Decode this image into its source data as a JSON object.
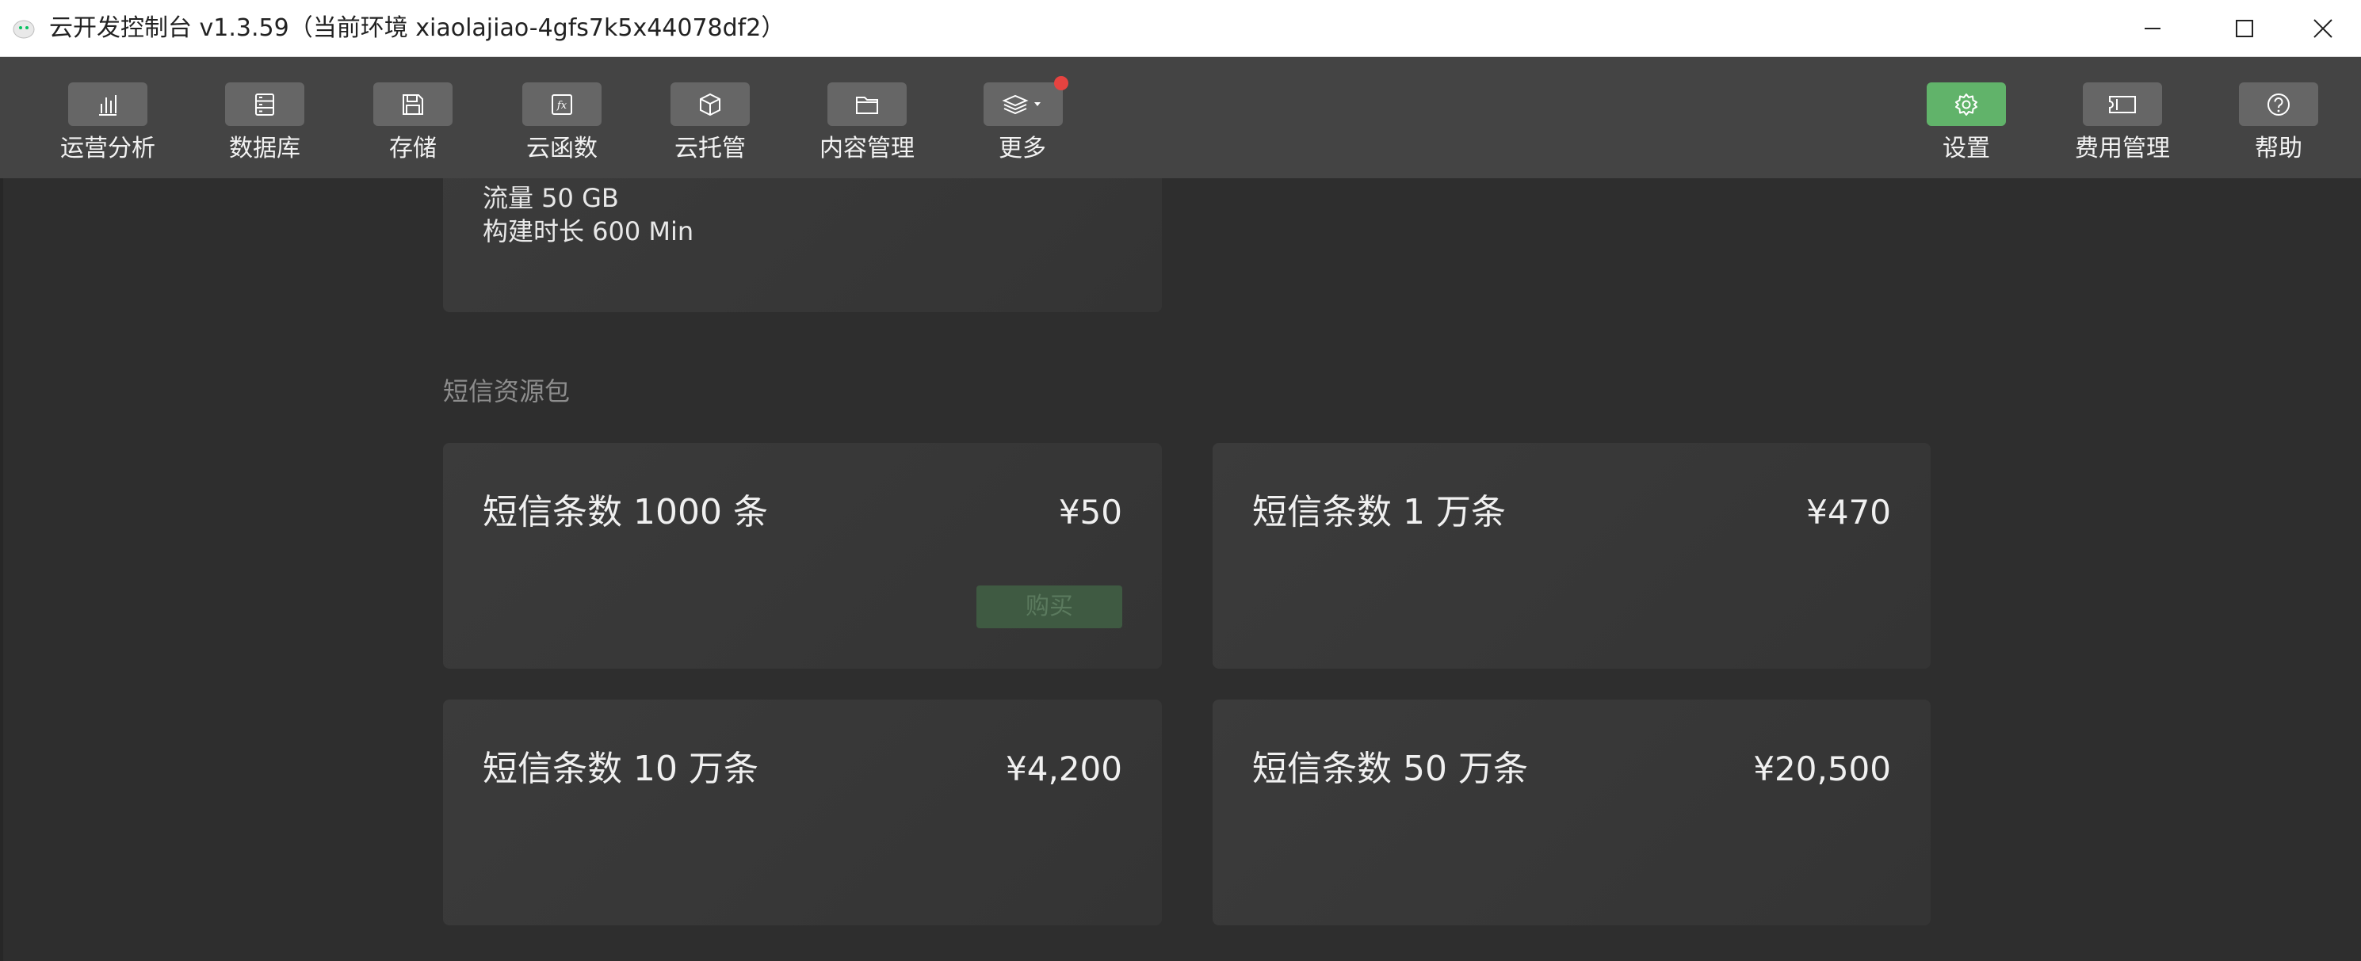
{
  "window": {
    "title": "云开发控制台 v1.3.59（当前环境 xiaolajiao-4gfs7k5x44078df2）",
    "icons": {
      "app": "wechat-cloud-logo-icon",
      "minimize": "minimize-icon",
      "maximize": "maximize-icon",
      "close": "close-icon"
    }
  },
  "toolbar": {
    "left_items": [
      {
        "label": "运营分析",
        "icon": "bar-chart-icon"
      },
      {
        "label": "数据库",
        "icon": "database-icon"
      },
      {
        "label": "存储",
        "icon": "floppy-disk-icon"
      },
      {
        "label": "云函数",
        "icon": "function-icon"
      },
      {
        "label": "云托管",
        "icon": "cube-icon"
      },
      {
        "label": "内容管理",
        "icon": "folder-icon"
      },
      {
        "label": "更多",
        "icon": "layers-icon"
      }
    ],
    "right_items": [
      {
        "label": "设置",
        "icon": "gear-icon"
      },
      {
        "label": "费用管理",
        "icon": "ticket-icon"
      },
      {
        "label": "帮助",
        "icon": "question-icon"
      }
    ],
    "fx_glyph": "fx",
    "colors": {
      "active": "#61b36a",
      "notification": "#e64340"
    }
  },
  "top_card": {
    "partial_line": "流量 50 GB",
    "build_line": "构建时长 600 Min"
  },
  "sms_section": {
    "title": "短信资源包",
    "packages": [
      {
        "name": "短信条数 1000 条",
        "price": "¥50",
        "action": "购买"
      },
      {
        "name": "短信条数 1 万条",
        "price": "¥470"
      },
      {
        "name": "短信条数 10 万条",
        "price": "¥4,200"
      },
      {
        "name": "短信条数 50 万条",
        "price": "¥20,500"
      }
    ]
  }
}
